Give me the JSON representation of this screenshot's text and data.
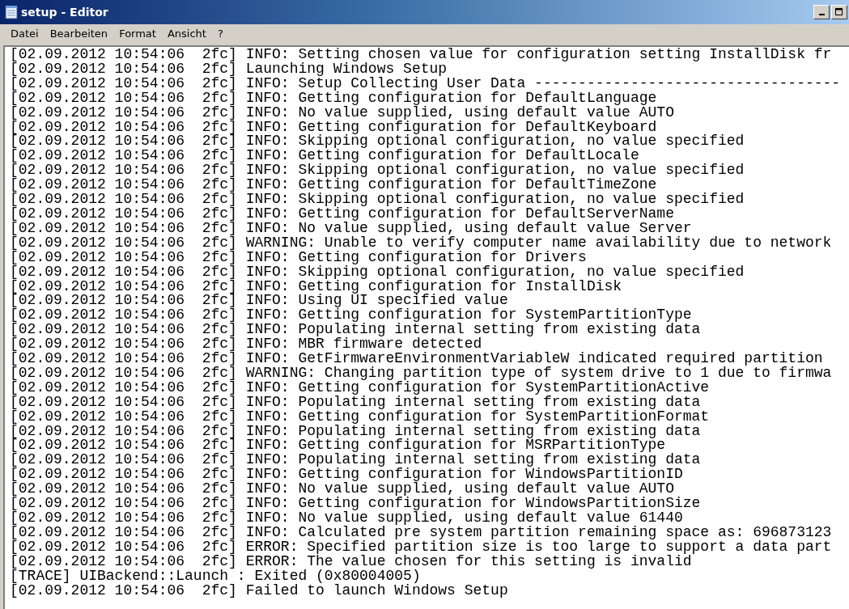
{
  "window": {
    "title": "setup - Editor"
  },
  "menu": [
    "Datei",
    "Bearbeiten",
    "Format",
    "Ansicht",
    "?"
  ],
  "lines": [
    "[02.09.2012 10:54:06  2fc] INFO: Setting chosen value for configuration setting InstallDisk fr",
    "[02.09.2012 10:54:06  2fc] Launching Windows Setup",
    "[02.09.2012 10:54:06  2fc] INFO: Setup Collecting User Data -----------------------------------",
    "[02.09.2012 10:54:06  2fc] INFO: Getting configuration for DefaultLanguage",
    "[02.09.2012 10:54:06  2fc] INFO: No value supplied, using default value AUTO",
    "[02.09.2012 10:54:06  2fc] INFO: Getting configuration for DefaultKeyboard",
    "[02.09.2012 10:54:06  2fc] INFO: Skipping optional configuration, no value specified",
    "[02.09.2012 10:54:06  2fc] INFO: Getting configuration for DefaultLocale",
    "[02.09.2012 10:54:06  2fc] INFO: Skipping optional configuration, no value specified",
    "[02.09.2012 10:54:06  2fc] INFO: Getting configuration for DefaultTimeZone",
    "[02.09.2012 10:54:06  2fc] INFO: Skipping optional configuration, no value specified",
    "[02.09.2012 10:54:06  2fc] INFO: Getting configuration for DefaultServerName",
    "[02.09.2012 10:54:06  2fc] INFO: No value supplied, using default value Server",
    "[02.09.2012 10:54:06  2fc] WARNING: Unable to verify computer name availability due to network",
    "[02.09.2012 10:54:06  2fc] INFO: Getting configuration for Drivers",
    "[02.09.2012 10:54:06  2fc] INFO: Skipping optional configuration, no value specified",
    "[02.09.2012 10:54:06  2fc] INFO: Getting configuration for InstallDisk",
    "[02.09.2012 10:54:06  2fc] INFO: Using UI specified value",
    "[02.09.2012 10:54:06  2fc] INFO: Getting configuration for SystemPartitionType",
    "[02.09.2012 10:54:06  2fc] INFO: Populating internal setting from existing data",
    "[02.09.2012 10:54:06  2fc] INFO: MBR firmware detected",
    "[02.09.2012 10:54:06  2fc] INFO: GetFirmwareEnvironmentVariableW indicated required partition",
    "[02.09.2012 10:54:06  2fc] WARNING: Changing partition type of system drive to 1 due to firmwa",
    "[02.09.2012 10:54:06  2fc] INFO: Getting configuration for SystemPartitionActive",
    "[02.09.2012 10:54:06  2fc] INFO: Populating internal setting from existing data",
    "[02.09.2012 10:54:06  2fc] INFO: Getting configuration for SystemPartitionFormat",
    "[02.09.2012 10:54:06  2fc] INFO: Populating internal setting from existing data",
    "[02.09.2012 10:54:06  2fc] INFO: Getting configuration for MSRPartitionType",
    "[02.09.2012 10:54:06  2fc] INFO: Populating internal setting from existing data",
    "[02.09.2012 10:54:06  2fc] INFO: Getting configuration for WindowsPartitionID",
    "[02.09.2012 10:54:06  2fc] INFO: No value supplied, using default value AUTO",
    "[02.09.2012 10:54:06  2fc] INFO: Getting configuration for WindowsPartitionSize",
    "[02.09.2012 10:54:06  2fc] INFO: No value supplied, using default value 61440",
    "[02.09.2012 10:54:06  2fc] INFO: Calculated pre system partition remaining space as: 696873123",
    "[02.09.2012 10:54:06  2fc] ERROR: Specified partition size is too large to support a data part",
    "[02.09.2012 10:54:06  2fc] ERROR: The value chosen for this setting is invalid",
    "[TRACE] UIBackend::Launch : Exited (0x80004005)",
    "[02.09.2012 10:54:06  2fc] Failed to launch Windows Setup"
  ]
}
